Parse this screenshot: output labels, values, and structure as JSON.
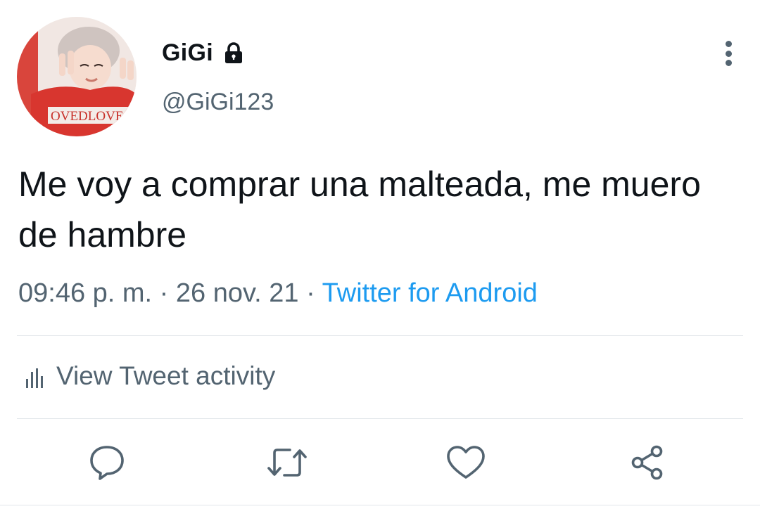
{
  "user": {
    "display_name": "GiGi",
    "handle": "@GiGi123",
    "protected": true,
    "avatar_icon": "profile-photo",
    "avatar_shirt_text": "OVEDLOVE"
  },
  "tweet": {
    "text": "Me voy a comprar una malteada, me muero de hambre",
    "time": "09:46 p. m.",
    "separator": " · ",
    "date": "26 nov. 21",
    "source": "Twitter for Android"
  },
  "activity": {
    "label": "View Tweet activity",
    "icon": "bar-chart-icon"
  },
  "actions": {
    "icons": [
      "reply-icon",
      "retweet-icon",
      "like-icon",
      "share-icon"
    ]
  },
  "colors": {
    "text": "#0f1419",
    "secondary": "#536471",
    "link": "#1d9bf0",
    "divider": "#e1e6ea"
  }
}
